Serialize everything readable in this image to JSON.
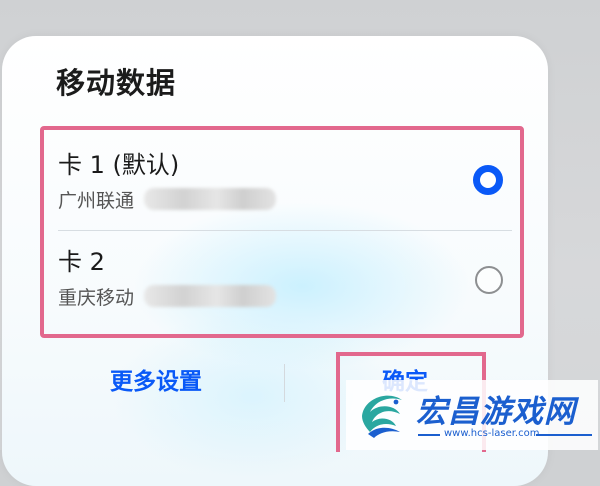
{
  "dialog": {
    "title": "移动数据",
    "options": [
      {
        "name": "卡 1 (默认)",
        "carrier": "广州联通",
        "selected": true
      },
      {
        "name": "卡 2",
        "carrier": "重庆移动",
        "selected": false
      }
    ],
    "actions": {
      "more_settings": "更多设置",
      "confirm": "确定"
    }
  },
  "watermark": {
    "title": "宏昌游戏网",
    "url": "www.hcs-laser.com"
  },
  "colors": {
    "accent": "#0a59f7",
    "highlight": "#e2688d",
    "watermark": "#1b5fcf"
  },
  "icons": {
    "selected": "radio-checked-icon",
    "unselected": "radio-unchecked-icon",
    "logo": "dragon-logo-icon"
  }
}
